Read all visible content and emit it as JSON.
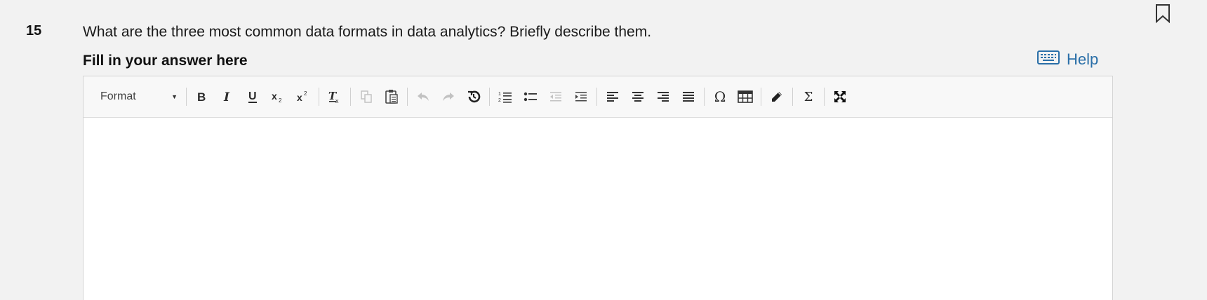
{
  "question": {
    "number": "15",
    "text": "What are the three most common data formats in data analytics? Briefly describe them."
  },
  "answer": {
    "label": "Fill in your answer here",
    "help_label": "Help",
    "content": ""
  },
  "toolbar": {
    "format_label": "Format",
    "sum_label": "Σ",
    "omega_label": "Ω"
  },
  "colors": {
    "help": "#2a6fa8",
    "background": "#f2f2f2",
    "toolbar_bg": "#f8f8f8"
  }
}
